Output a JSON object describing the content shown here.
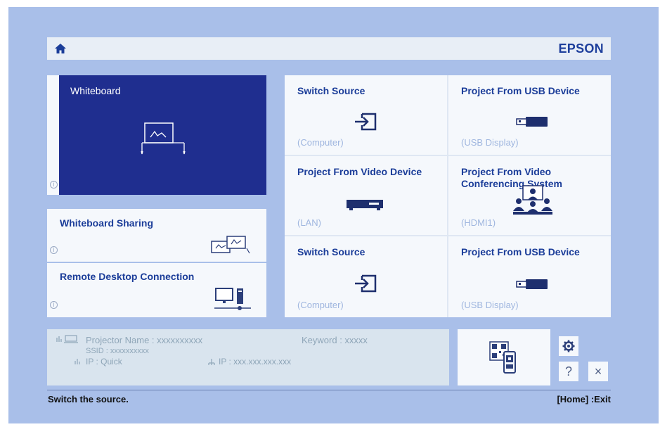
{
  "header": {
    "brand": "EPSON",
    "home_icon": "home-icon"
  },
  "whiteboard": {
    "title": "Whiteboard",
    "icon": "whiteboard-icon"
  },
  "left_tiles": [
    {
      "title": "Whiteboard Sharing",
      "icon": "whiteboard-sharing-icon"
    },
    {
      "title": "Remote Desktop Connection",
      "icon": "remote-desktop-icon"
    }
  ],
  "tiles": [
    {
      "title": "Switch Source",
      "sub": "(Computer)",
      "icon": "input-source-icon"
    },
    {
      "title": "Project From USB Device",
      "sub": "(USB Display)",
      "icon": "usb-device-icon"
    },
    {
      "title": "Project From Video Device",
      "sub": "(LAN)",
      "icon": "video-device-icon"
    },
    {
      "title": "Project From Video Conferencing System",
      "sub": "(HDMI1)",
      "icon": "video-conference-icon"
    },
    {
      "title": "Switch Source",
      "sub": "(Computer)",
      "icon": "input-source-icon"
    },
    {
      "title": "Project From USB Device",
      "sub": "(USB Display)",
      "icon": "usb-device-icon"
    }
  ],
  "info": {
    "projector_name": "Projector Name : xxxxxxxxxx",
    "ssid": "SSID : xxxxxxxxxx",
    "wireless_ip": "IP : Quick",
    "keyword": "Keyword : xxxxx",
    "wired_ip": "IP : xxx.xxx.xxx.xxx"
  },
  "buttons": {
    "settings_icon": "gear-icon",
    "help_label": "?",
    "close_label": "×"
  },
  "status": {
    "message": "Switch the source.",
    "hint": "[Home] :Exit"
  }
}
